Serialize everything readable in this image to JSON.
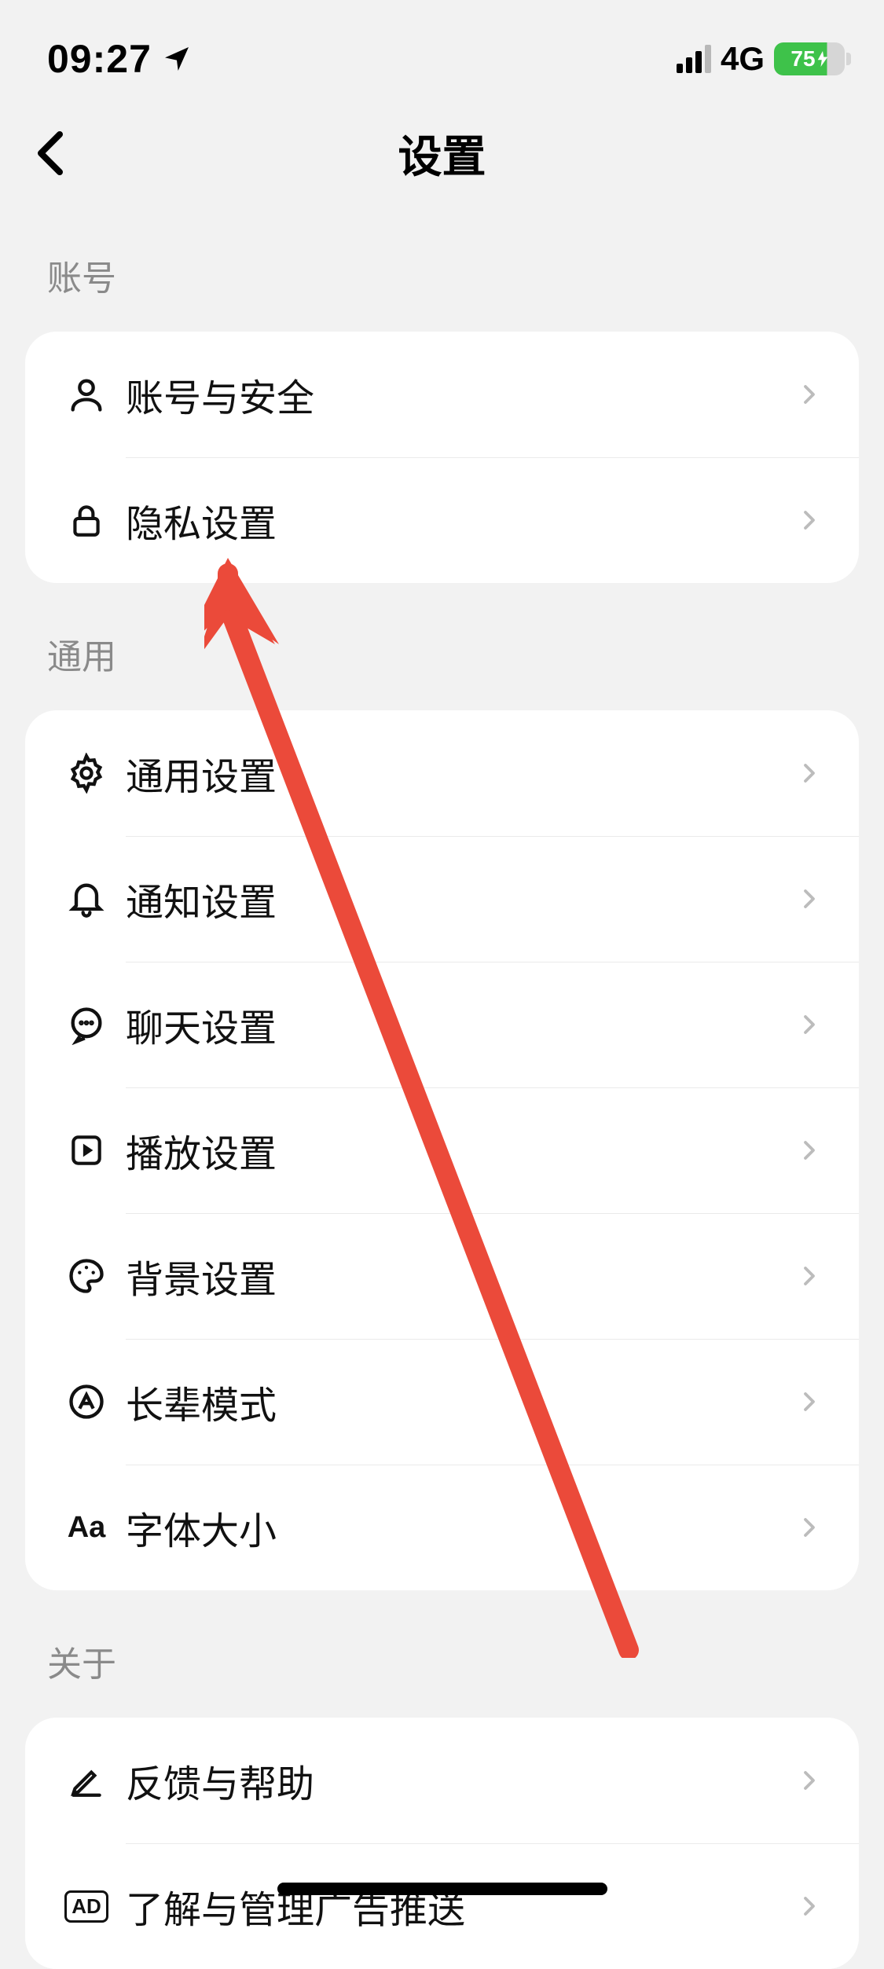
{
  "status": {
    "time": "09:27",
    "network": "4G",
    "battery": "75"
  },
  "nav": {
    "title": "设置"
  },
  "sections": {
    "account": {
      "header": "账号",
      "rows": {
        "accountSecurity": "账号与安全",
        "privacy": "隐私设置"
      }
    },
    "general": {
      "header": "通用",
      "rows": {
        "general": "通用设置",
        "notification": "通知设置",
        "chat": "聊天设置",
        "playback": "播放设置",
        "background": "背景设置",
        "elder": "长辈模式",
        "font": "字体大小"
      }
    },
    "about": {
      "header": "关于",
      "rows": {
        "feedback": "反馈与帮助",
        "ads": "了解与管理广告推送"
      }
    }
  },
  "icons": {
    "fontAa": "Aa",
    "adLabel": "AD"
  }
}
